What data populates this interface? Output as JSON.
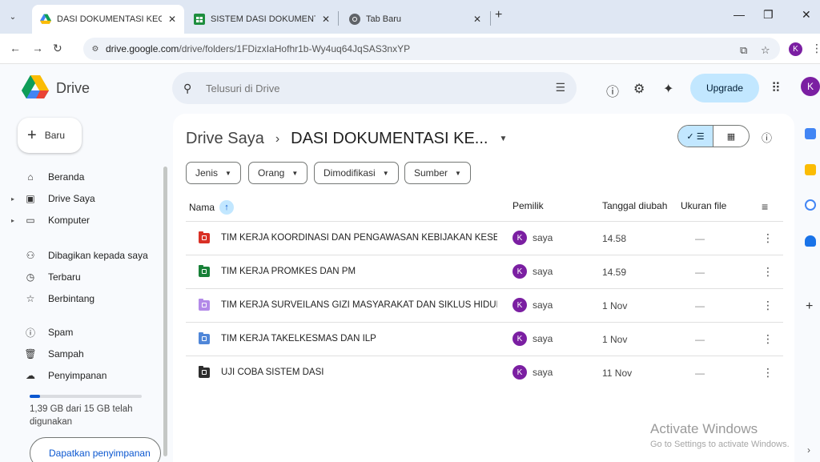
{
  "browser": {
    "tabs": [
      {
        "label": "DASI DOKUMENTASI KEGIATAN",
        "close": "✕",
        "favicon": "google-drive-icon"
      },
      {
        "label": "SISTEM DASI DOKUMENTASI K",
        "close": "✕",
        "favicon": "google-sheets-icon"
      },
      {
        "label": "Tab Baru",
        "close": "✕",
        "favicon": "chrome-icon"
      }
    ],
    "new_tab": "+",
    "url_host": "drive.google.com",
    "url_path": "/drive/folders/1FDizxIaHofhr1b-Wy4uq64JqSAS3nxYP",
    "profile_initial": "K"
  },
  "drive": {
    "app_name": "Drive",
    "search_placeholder": "Telusuri di Drive",
    "upgrade_label": "Upgrade",
    "avatar_initial": "K"
  },
  "sidebar": {
    "new_label": "Baru",
    "items": [
      {
        "label": "Beranda",
        "icon": "home-icon"
      },
      {
        "label": "Drive Saya",
        "icon": "my-drive-icon"
      },
      {
        "label": "Komputer",
        "icon": "computer-icon"
      },
      {
        "label": "Dibagikan kepada saya",
        "icon": "shared-icon"
      },
      {
        "label": "Terbaru",
        "icon": "clock-icon"
      },
      {
        "label": "Berbintang",
        "icon": "star-icon"
      },
      {
        "label": "Spam",
        "icon": "spam-icon"
      },
      {
        "label": "Sampah",
        "icon": "trash-icon"
      },
      {
        "label": "Penyimpanan",
        "icon": "cloud-icon"
      }
    ],
    "storage_text": "1,39 GB dari 15 GB telah digunakan",
    "storage_fraction": 0.093,
    "get_storage_label": "Dapatkan penyimpanan"
  },
  "main": {
    "breadcrumb_root": "Drive Saya",
    "breadcrumb_sep": "›",
    "breadcrumb_current": "DASI DOKUMENTASI KE...",
    "filters": [
      "Jenis",
      "Orang",
      "Dimodifikasi",
      "Sumber"
    ],
    "columns": {
      "name": "Nama",
      "owner": "Pemilik",
      "modified": "Tanggal diubah",
      "size": "Ukuran file"
    },
    "rows": [
      {
        "name": "TIM KERJA KOORDINASI DAN PENGAWASAN KEBIJAKAN KESE...",
        "owner": "saya",
        "owner_initial": "K",
        "modified": "14.58",
        "size": "—",
        "folder_color": "#d93025"
      },
      {
        "name": "TIM KERJA PROMKES DAN PM",
        "owner": "saya",
        "owner_initial": "K",
        "modified": "14.59",
        "size": "—",
        "folder_color": "#188038"
      },
      {
        "name": "TIM KERJA SURVEILANS GIZI MASYARAKAT DAN SIKLUS HIDUP",
        "owner": "saya",
        "owner_initial": "K",
        "modified": "1 Nov",
        "size": "—",
        "folder_color": "#b38ae8"
      },
      {
        "name": "TIM KERJA TAKELKESMAS DAN ILP",
        "owner": "saya",
        "owner_initial": "K",
        "modified": "1 Nov",
        "size": "—",
        "folder_color": "#4f86d8"
      },
      {
        "name": "UJI COBA SISTEM DASI",
        "owner": "saya",
        "owner_initial": "K",
        "modified": "11 Nov",
        "size": "—",
        "folder_color": "#2d2d2d"
      }
    ]
  },
  "watermark": {
    "line1": "Activate Windows",
    "line2": "Go to Settings to activate Windows."
  }
}
